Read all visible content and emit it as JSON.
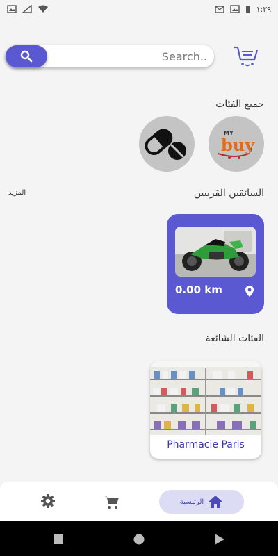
{
  "status_bar": {
    "time": "١:٣٩"
  },
  "search": {
    "placeholder": "Search.."
  },
  "sections": {
    "categories_title": "جميع الفئات",
    "drivers_title": "السائقين القريبين",
    "more_label": "المزيد",
    "popular_title": "الفئات الشائعة"
  },
  "categories": [
    {
      "name": "MyBuy",
      "logo_top": "MY",
      "logo_main": "buy",
      "logo_suffix": ".it"
    },
    {
      "name": "Pharmacy",
      "icon": "pill-icon"
    }
  ],
  "driver_card": {
    "distance": "0.00 km",
    "icon": "location-pin-icon"
  },
  "popular": [
    {
      "name": "Pharmacie Paris"
    }
  ],
  "bottom_nav": {
    "home_label": "الرئيسية",
    "items": [
      "settings-icon",
      "cart-icon",
      "home-icon"
    ]
  },
  "colors": {
    "accent": "#5a59d2",
    "accent_light": "#dcdcf4",
    "background": "#f4f4f4"
  }
}
